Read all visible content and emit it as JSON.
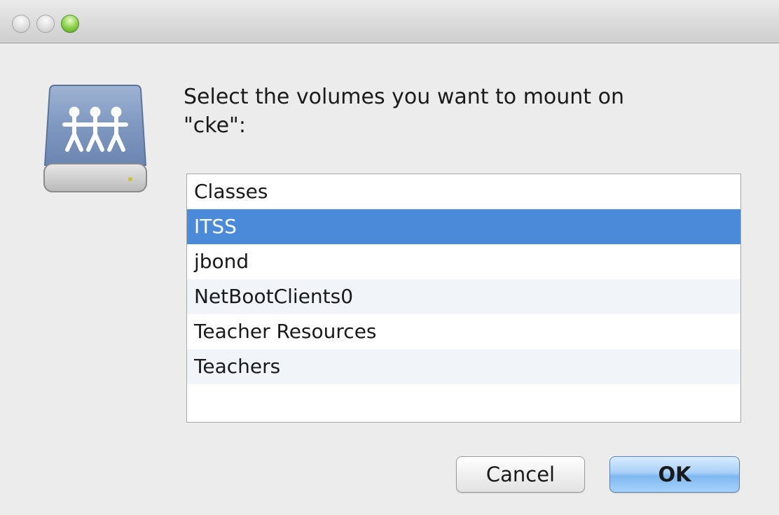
{
  "dialog": {
    "prompt_line1": "Select the volumes you want to mount on",
    "prompt_line2": "\"cke\":",
    "icon": "network-share-drive-icon"
  },
  "volumes": {
    "items": [
      {
        "label": "Classes",
        "selected": false
      },
      {
        "label": "ITSS",
        "selected": true
      },
      {
        "label": "jbond",
        "selected": false
      },
      {
        "label": "NetBootClients0",
        "selected": false
      },
      {
        "label": "Teacher Resources",
        "selected": false
      },
      {
        "label": "Teachers",
        "selected": false
      }
    ]
  },
  "buttons": {
    "cancel_label": "Cancel",
    "ok_label": "OK"
  },
  "colors": {
    "selection": "#4a8ad8",
    "window_bg": "#ececec",
    "zoom_button": "#86cf45"
  }
}
